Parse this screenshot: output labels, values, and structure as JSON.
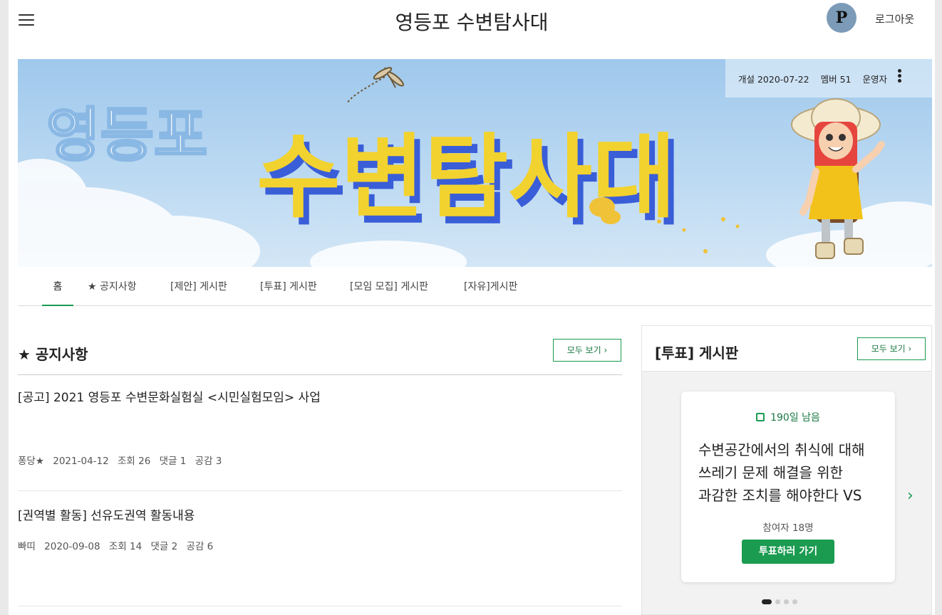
{
  "header": {
    "title": "영등포 수변탐사대",
    "avatar_letter": "P",
    "logout_label": "로그아웃"
  },
  "banner": {
    "title_small": "영등포",
    "title_big": "수변탐사대",
    "opened": "개설 2020-07-22",
    "members": "멤버 51",
    "operator": "운영자",
    "sky_color": "#a9cfee",
    "title_yellow": "#f2d22e",
    "title_blue": "#3a5ed8"
  },
  "tabs": [
    "홈",
    "★ 공지사항",
    "[제안] 게시판",
    "[투표] 게시판",
    "[모임 모집] 게시판",
    "[자유]게시판"
  ],
  "notice": {
    "title": "★ 공지사항",
    "see_all": "모두 보기 ›",
    "posts": [
      {
        "title": "[공고] 2021 영등포 수변문화실험실 <시민실험모임> 사업",
        "author": "퐁당★",
        "date": "2021-04-12",
        "views": "조회 26",
        "comments": "댓글 1",
        "likes": "공감 3"
      },
      {
        "title": "[권역별 활동] 선유도권역 활동내용",
        "author": "빠띠",
        "date": "2020-09-08",
        "views": "조회 14",
        "comments": "댓글 2",
        "likes": "공감 6"
      }
    ]
  },
  "vote_board": {
    "title": "[투표] 게시판",
    "see_all": "모두 보기 ›",
    "card": {
      "icon": "hourglass-icon",
      "remaining": "190일 남음",
      "lines": [
        "수변공간에서의 취식에 대해",
        "쓰레기 문제 해결을 위한",
        "과감한 조치를 해야한다 VS"
      ],
      "participants": "참여자 18명",
      "button": "투표하러 가기"
    },
    "page_count": 4,
    "current_page": 1
  },
  "accent_color": "#1a9b50"
}
